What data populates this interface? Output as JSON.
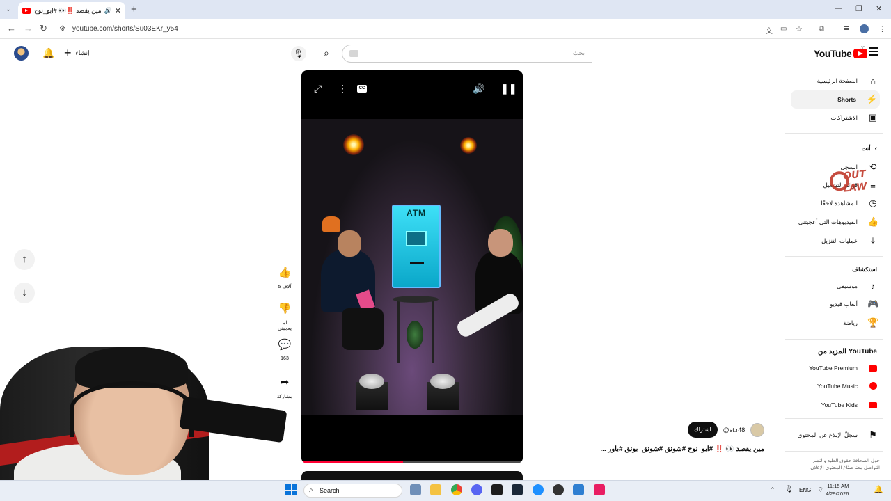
{
  "browser": {
    "tab_title": "مين يقصد ‼️👀 #ابو_نوح #شور",
    "url": "youtube.com/shorts/Su03EKr_y54",
    "close": "✕",
    "new_tab": "+"
  },
  "header": {
    "logo_text": "YouTube",
    "country": "JO",
    "search_placeholder": "بحث",
    "create_label": "إنشاء"
  },
  "sidebar": {
    "main": [
      {
        "label": "الصفحة الرئيسية",
        "icon": "home-icon",
        "glyph": "⌂"
      },
      {
        "label": "Shorts",
        "icon": "shorts-icon",
        "glyph": "⚡"
      },
      {
        "label": "الاشتراكات",
        "icon": "subscriptions-icon",
        "glyph": "▣"
      }
    ],
    "you_header": "أنت",
    "you": [
      {
        "label": "السجل",
        "icon": "history-icon",
        "glyph": "⟲"
      },
      {
        "label": "قوائم التشغيل",
        "icon": "playlists-icon",
        "glyph": "≡"
      },
      {
        "label": "المشاهدة لاحقًا",
        "icon": "watch-later-icon",
        "glyph": "◷"
      },
      {
        "label": "الفيديوهات التي أعجبتني",
        "icon": "liked-icon",
        "glyph": "👍"
      },
      {
        "label": "عمليات التنزيل",
        "icon": "download-icon",
        "glyph": "⤓"
      }
    ],
    "explore_header": "استكشاف",
    "explore": [
      {
        "label": "موسيقى",
        "icon": "music-icon",
        "glyph": "♪"
      },
      {
        "label": "ألعاب فيديو",
        "icon": "gaming-icon",
        "glyph": "🎮"
      },
      {
        "label": "رياضة",
        "icon": "trophy-icon",
        "glyph": "🏆"
      }
    ],
    "more_header": "المزيد من YouTube",
    "more": [
      {
        "label": "YouTube Premium",
        "icon": "youtube-premium-icon"
      },
      {
        "label": "YouTube Music",
        "icon": "youtube-music-icon"
      },
      {
        "label": "YouTube Kids",
        "icon": "youtube-kids-icon"
      }
    ],
    "report": "سجلّ الإبلاغ عن المحتوى",
    "footer_line1": "حول  الصحافة  حقوق الطبع والنشر",
    "footer_line2": "التواصل معنا  صنّاع المحتوى  الإعلان"
  },
  "watermark": "OUT LAW",
  "short": {
    "atm_label": "ATM",
    "channel_handle": "@st.r48",
    "subscribe_label": "اشتراك",
    "caption": "مين يقصد 👀 ‼️ #ابو_نوح #شونق #شونق_بونق #باور ...",
    "progress": 0.46
  },
  "actions": {
    "likes": "5 آلاف",
    "dislike": "لم يعجبني",
    "comments": "163",
    "share": "مشاركة"
  },
  "taskbar": {
    "search": "Search",
    "lang": "ENG",
    "time": "11:15 AM",
    "date": "4/29/2026"
  }
}
